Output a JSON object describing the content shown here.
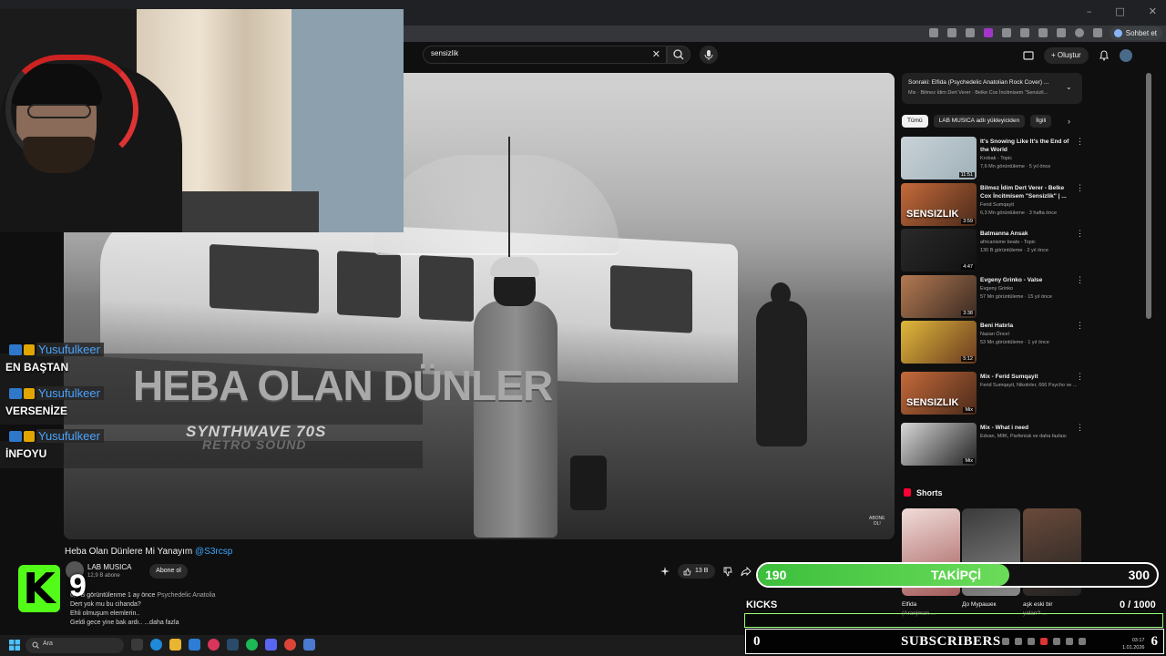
{
  "browser": {
    "chat_button": "Sohbet et",
    "window_controls": [
      "–",
      "□",
      "✕"
    ]
  },
  "header": {
    "search_value": "sensizlik",
    "create_label": "Oluştur"
  },
  "video": {
    "song_title": "HEBA OLAN DÜNLER",
    "subtitle1": "SYNTHWAVE 70S",
    "subtitle2": "RETRO SOUND",
    "watermark_line1": "ABONE",
    "watermark_line2": "OL!"
  },
  "chat": [
    {
      "user": "Yusufulkeer",
      "message": "EN BAŞTAN"
    },
    {
      "user": "Yusufulkeer",
      "message": "VERSENİZE"
    },
    {
      "user": "Yusufulkeer",
      "message": "İNFOYU"
    }
  ],
  "under_video": {
    "title": "Heba Olan Dünlere Mi Yanayım",
    "title_tag": "@S3rcsp",
    "channel": "LAB MUSICA",
    "subs": "12,9 B abone",
    "subscribe_label": "Abone ol",
    "likes": "13 B",
    "desc_views": "6,9 B görüntülenme  1 ay önce",
    "desc_tag": "Psychedelic Anatolia",
    "desc_line2": "Dert yok mu bu cihanda?",
    "desc_line3": "Ehli olmuşum elemlerin..",
    "desc_line4": "Geldi gece yine bak ardı..",
    "desc_more": "...daha fazla"
  },
  "sidebar": {
    "next_title": "Sonraki: Elfida (Psychedelic Anatolian Rock Cover) ...",
    "next_sub": "Mix · Bilmez İdim Dert Verer · Belke Cox İncitmisem \"Sensizli...",
    "chips": [
      "Tümü",
      "LAB MUSICA adlı yükleyiciden",
      "İlgili"
    ],
    "recs": [
      {
        "title": "It's Snowing Like It's the End of the World",
        "channel": "Krobak - Topic",
        "meta": "7,6 Mn görüntüleme · 5 yıl önce",
        "duration": "11:51",
        "colors": [
          "#c9d3d8",
          "#9fb0b8"
        ]
      },
      {
        "title": "Bilmez İdim Dert Verer - Belke Cox İncitmisem \"Sensizlik\" | ...",
        "channel": "Ferid Sumqayit",
        "meta": "6,3 Mn görüntüleme · 3 hafta önce",
        "duration": "3:59",
        "colors": [
          "#c56a3a",
          "#4a2a1a"
        ],
        "overlay": "SENSIZLIK"
      },
      {
        "title": "Batmanna Ansak",
        "channel": "africanisme beats - Topic",
        "meta": "130 B görüntüleme · 2 yıl önce",
        "duration": "4:47",
        "colors": [
          "#2a2a2a",
          "#111111"
        ]
      },
      {
        "title": "Evgeny Grinko - Valse",
        "channel": "Evgeny Grinko",
        "meta": "57 Mn görüntüleme · 15 yıl önce",
        "duration": "3:38",
        "colors": [
          "#b47a52",
          "#3a2a22"
        ]
      },
      {
        "title": "Beni Hatırla",
        "channel": "Nazan Öncel",
        "meta": "53 Mn görüntüleme · 1 yıl önce",
        "duration": "5:12",
        "colors": [
          "#e0b93a",
          "#6a3a20"
        ]
      },
      {
        "title": "Mix - Ferid Sumqayit",
        "channel": "Ferid Sumqayit, Nikolnler, 666 Psycho ve ...",
        "meta": "",
        "duration": "Mix",
        "colors": [
          "#c56a3a",
          "#4a2a1a"
        ],
        "overlay": "SENSIZLIK"
      },
      {
        "title": "Mix - What i need",
        "channel": "Edvan, MIIK, Parfeniuk ve daha fazlası",
        "meta": "",
        "duration": "Mix",
        "colors": [
          "#d8d8d8",
          "#222222"
        ]
      }
    ],
    "shorts_label": "Shorts",
    "shorts": [
      {
        "label": "Elfida",
        "label2": "(Aranjman ...",
        "colors": [
          "#f0dcd8",
          "#a35a5a"
        ]
      },
      {
        "label": "До Мурашек",
        "label2": "",
        "colors": [
          "#3a3a3a",
          "#888888"
        ]
      },
      {
        "label": "aşk eski bir",
        "label2": "yalan? ...",
        "colors": [
          "#6a4a3a",
          "#222222"
        ]
      }
    ]
  },
  "kick": {
    "logo": "K",
    "viewers": "9"
  },
  "goals": {
    "followers_current": "190",
    "followers_label": "TAKİPÇİ",
    "followers_target": "300",
    "followers_progress": 0.63,
    "kicks_label": "KICKS",
    "kicks_value": "0  / 1000",
    "kicks_progress": 0.0,
    "subs_current": "0",
    "subs_label": "SUBSCRIBERS",
    "subs_target": "6"
  },
  "taskbar": {
    "search_placeholder": "Ara",
    "time": "03:17",
    "date": "1.01.2026"
  },
  "colors": {
    "kick_green": "#53fc18",
    "youtube_red": "#ff0033",
    "chat_user": "#4aa3ff"
  }
}
